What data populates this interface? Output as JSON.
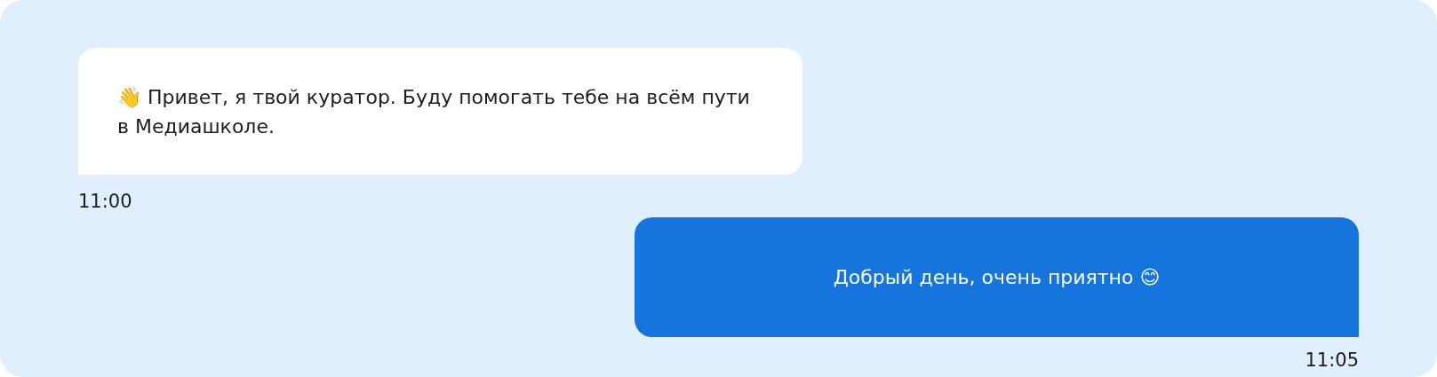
{
  "messages": [
    {
      "kind": "incoming",
      "text": "👋 Привет, я твой куратор. Буду помогать тебе на всём пути в Медиашколе.",
      "time": "11:00"
    },
    {
      "kind": "outgoing",
      "text": "Добрый день, очень приятно 😊",
      "time": "11:05"
    }
  ]
}
